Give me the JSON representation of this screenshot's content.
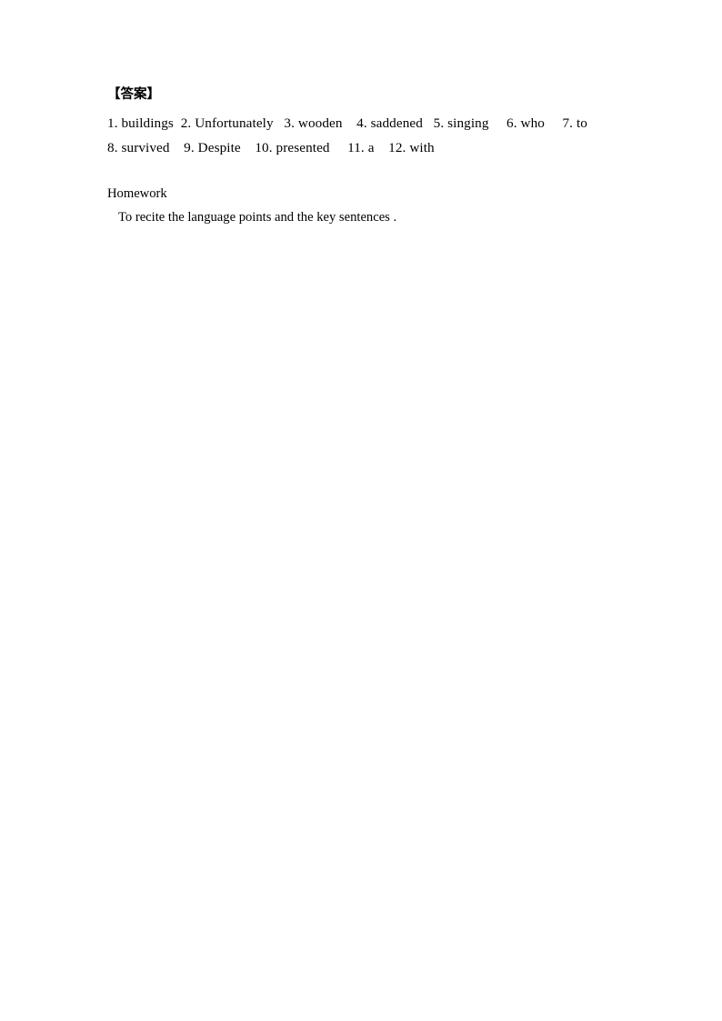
{
  "document": {
    "answer_key": {
      "heading": "【答案】",
      "lines": [
        "1. buildings  2. Unfortunately   3. wooden    4. saddened   5. singing     6. who     7. to",
        "8. survived    9. Despite    10. presented     11. a    12. with"
      ],
      "items": [
        {
          "number": "1.",
          "answer": "buildings"
        },
        {
          "number": "2.",
          "answer": "Unfortunately"
        },
        {
          "number": "3.",
          "answer": "wooden"
        },
        {
          "number": "4.",
          "answer": "saddened"
        },
        {
          "number": "5.",
          "answer": "singing"
        },
        {
          "number": "6.",
          "answer": "who"
        },
        {
          "number": "7.",
          "answer": "to"
        },
        {
          "number": "8.",
          "answer": "survived"
        },
        {
          "number": "9.",
          "answer": "Despite"
        },
        {
          "number": "10.",
          "answer": "presented"
        },
        {
          "number": "11.",
          "answer": "a"
        },
        {
          "number": "12.",
          "answer": "with"
        }
      ]
    },
    "homework": {
      "heading": "Homework",
      "body": "To recite the language points and the key sentences ."
    }
  }
}
